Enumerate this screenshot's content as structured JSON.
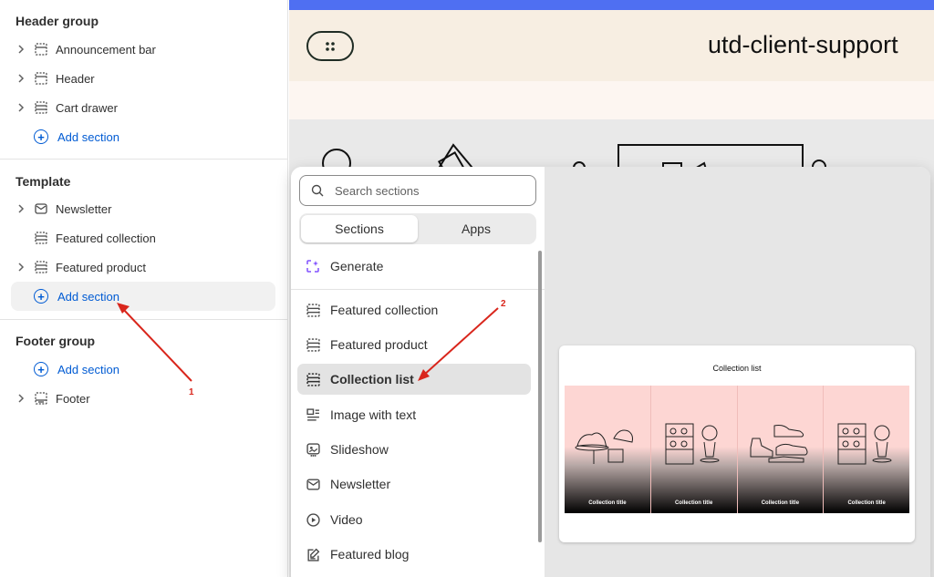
{
  "sidebar": {
    "groups": [
      {
        "title": "Header group",
        "items": [
          {
            "label": "Announcement bar",
            "icon": "section-icon",
            "expandable": true
          },
          {
            "label": "Header",
            "icon": "section-icon",
            "expandable": true
          },
          {
            "label": "Cart drawer",
            "icon": "section-icon",
            "expandable": true
          }
        ],
        "add_label": "Add section"
      },
      {
        "title": "Template",
        "items": [
          {
            "label": "Newsletter",
            "icon": "mail-icon",
            "expandable": true
          },
          {
            "label": "Featured collection",
            "icon": "section-icon",
            "expandable": false
          },
          {
            "label": "Featured product",
            "icon": "section-icon",
            "expandable": true
          }
        ],
        "add_label": "Add section"
      },
      {
        "title": "Footer group",
        "add_label": "Add section",
        "items": [
          {
            "label": "Footer",
            "icon": "footer-icon",
            "expandable": true
          }
        ]
      }
    ]
  },
  "preview": {
    "store_title": "utd-client-support",
    "accent_color": "#4f6ff2"
  },
  "picker": {
    "search_placeholder": "Search sections",
    "tabs": [
      {
        "label": "Sections",
        "active": true
      },
      {
        "label": "Apps",
        "active": false
      }
    ],
    "generate_label": "Generate",
    "sections": [
      {
        "label": "Featured collection",
        "icon": "section-icon",
        "selected": false
      },
      {
        "label": "Featured product",
        "icon": "section-icon",
        "selected": false
      },
      {
        "label": "Collection list",
        "icon": "section-icon",
        "selected": true
      },
      {
        "label": "Image with text",
        "icon": "image-text-icon",
        "selected": false
      },
      {
        "label": "Slideshow",
        "icon": "slideshow-icon",
        "selected": false
      },
      {
        "label": "Newsletter",
        "icon": "mail-icon",
        "selected": false
      },
      {
        "label": "Video",
        "icon": "play-icon",
        "selected": false
      },
      {
        "label": "Featured blog",
        "icon": "blog-icon",
        "selected": false
      }
    ],
    "preview_card": {
      "title": "Collection list",
      "tiles": [
        "Collection title",
        "Collection title",
        "Collection title",
        "Collection title"
      ]
    }
  },
  "annotations": {
    "arrow_1_label": "1",
    "arrow_2_label": "2",
    "color": "#d9261c"
  }
}
